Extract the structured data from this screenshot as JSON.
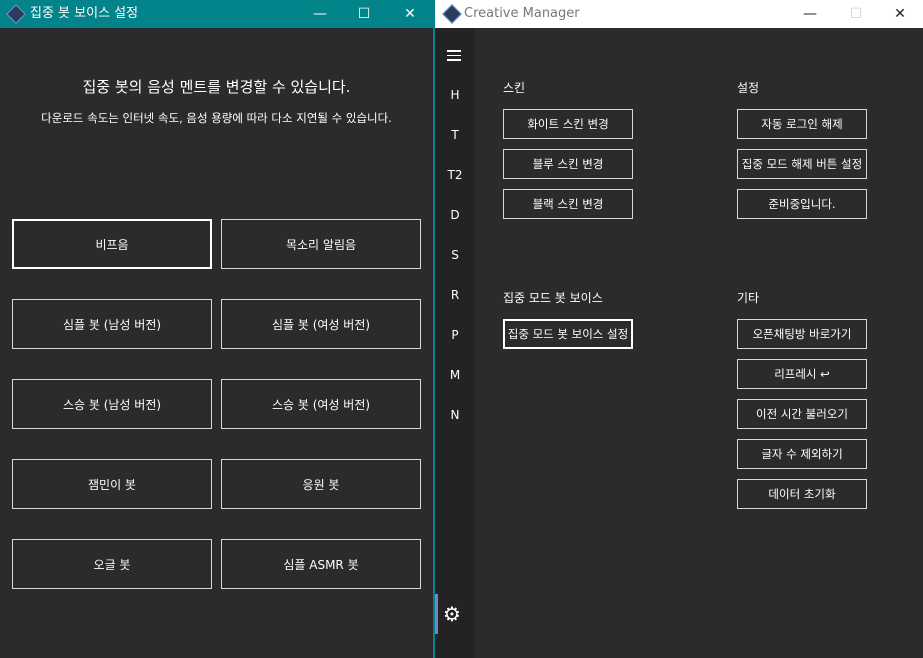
{
  "left_window": {
    "title": "집중 봇 보이스 설정",
    "controls": {
      "minimize": "—",
      "maximize": "☐",
      "close": "✕"
    },
    "heading": "집중 봇의 음성 멘트를 변경할 수 있습니다.",
    "description": "다운로드 속도는 인터넷 속도, 음성 용량에 따라 다소 지연될 수 있습니다.",
    "voices": [
      {
        "label": "비프음"
      },
      {
        "label": "목소리 알림음"
      },
      {
        "label": "심플 봇 (남성 버전)"
      },
      {
        "label": "심플 봇 (여성 버전)"
      },
      {
        "label": "스승 봇 (남성 버전)"
      },
      {
        "label": "스승 봇 (여성 버전)"
      },
      {
        "label": "잼민이 봇"
      },
      {
        "label": "응원 봇"
      },
      {
        "label": "오글 봇"
      },
      {
        "label": "심플 ASMR 봇"
      }
    ],
    "selected_voice": "비프음"
  },
  "right_window": {
    "title": "Creative Manager",
    "controls": {
      "minimize": "—",
      "maximize": "☐",
      "close": "✕"
    },
    "nav": {
      "menu_icon": "hamburger-icon",
      "items": [
        "H",
        "T",
        "T2",
        "D",
        "S",
        "R",
        "P",
        "M",
        "N"
      ],
      "settings_icon": "gear-icon"
    },
    "sections": {
      "skin": {
        "title": "스킨",
        "buttons": [
          "화이트 스킨 변경",
          "블루 스킨 변경",
          "블랙 스킨 변경"
        ]
      },
      "settings": {
        "title": "설정",
        "buttons": [
          "자동 로그인 해제",
          "집중 모드 해제 버튼 설정",
          "준비중입니다."
        ]
      },
      "focus_voice": {
        "title": "집중 모드 봇 보이스",
        "buttons": [
          "집중 모드 봇 보이스 설정"
        ]
      },
      "etc": {
        "title": "기타",
        "buttons": [
          "오픈채팅방 바로가기",
          "리프레시 ↩",
          "이전 시간 불러오기",
          "글자 수 제외하기",
          "데이터 초기화"
        ]
      }
    }
  },
  "colors": {
    "titlebar_teal": "#03838a",
    "panel_bg": "#2b2b2d",
    "nav_bg": "#232325",
    "accent_indicator": "#7b7fd6"
  }
}
